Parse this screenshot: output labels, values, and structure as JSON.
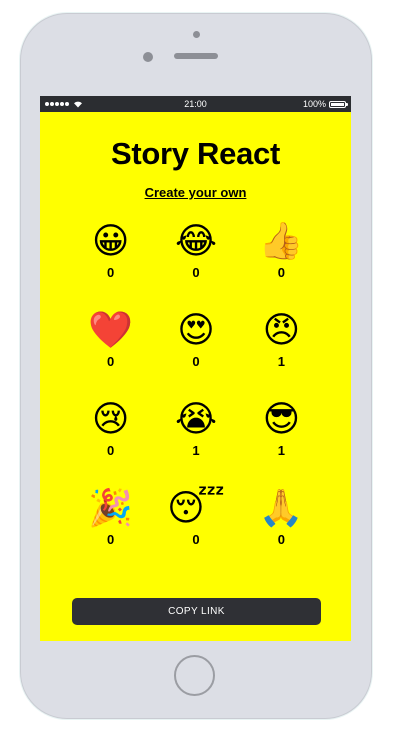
{
  "status_bar": {
    "time": "21:00",
    "battery": "100%",
    "icons": [
      "signal-dots",
      "wifi-icon",
      "battery-icon"
    ]
  },
  "app": {
    "title": "Story React",
    "create_link": "Create your own",
    "copy_button": "COPY LINK"
  },
  "reactions": [
    {
      "emoji": "😀",
      "icon": "grinning-face-icon",
      "count": "0"
    },
    {
      "emoji": "😂",
      "icon": "tears-of-joy-icon",
      "count": "0"
    },
    {
      "emoji": "👍",
      "icon": "thumbs-up-icon",
      "count": "0"
    },
    {
      "emoji": "❤️",
      "icon": "red-heart-icon",
      "count": "0"
    },
    {
      "emoji": "😍",
      "icon": "heart-eyes-icon",
      "count": "0"
    },
    {
      "emoji": "😠",
      "icon": "angry-face-icon",
      "count": "1"
    },
    {
      "emoji": "😢",
      "icon": "crying-face-icon",
      "count": "0"
    },
    {
      "emoji": "😭",
      "icon": "loudly-crying-icon",
      "count": "1"
    },
    {
      "emoji": "😎",
      "icon": "sunglasses-face-icon",
      "count": "1"
    },
    {
      "emoji": "🎉",
      "icon": "party-popper-icon",
      "count": "0"
    },
    {
      "emoji": "😴",
      "icon": "sleeping-face-icon",
      "count": "0"
    },
    {
      "emoji": "🙏",
      "icon": "folded-hands-icon",
      "count": "0"
    }
  ],
  "colors": {
    "screen_background": "#ffff00",
    "button_background": "#2f3035",
    "device_body": "#dcdee5"
  }
}
